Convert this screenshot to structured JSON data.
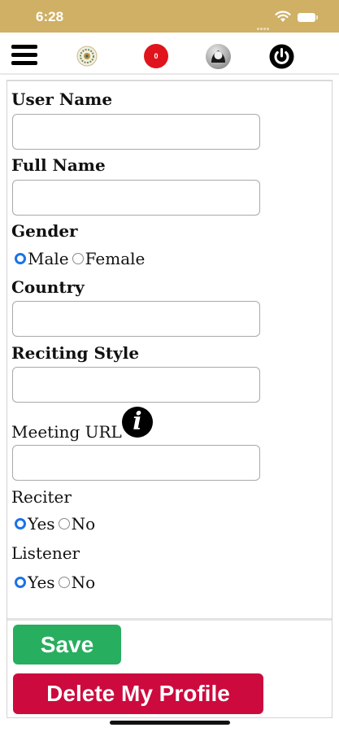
{
  "status_bar": {
    "time": "6:28"
  },
  "toolbar": {
    "notification_count": "0",
    "icons": [
      "menu-icon",
      "logo-icon",
      "notification-badge-icon",
      "user-avatar-icon",
      "power-icon"
    ]
  },
  "form": {
    "user_name": {
      "label": "User Name",
      "value": ""
    },
    "full_name": {
      "label": "Full Name",
      "value": ""
    },
    "gender": {
      "label": "Gender",
      "options": [
        "Male",
        "Female"
      ],
      "selected": "Male"
    },
    "country": {
      "label": "Country",
      "value": ""
    },
    "reciting_style": {
      "label": "Reciting Style",
      "value": ""
    },
    "meeting_url": {
      "label": "Meeting URL",
      "value": ""
    },
    "reciter": {
      "label": "Reciter",
      "options": [
        "Yes",
        "No"
      ],
      "selected": "Yes"
    },
    "listener": {
      "label": "Listener",
      "options": [
        "Yes",
        "No"
      ],
      "selected": "Yes"
    }
  },
  "buttons": {
    "save": "Save",
    "delete": "Delete My Profile"
  },
  "colors": {
    "status_bar": "#cfb065",
    "save": "#27ae5f",
    "delete": "#cc0a3e",
    "radio_selected": "#1a73e8",
    "notification_badge": "#e0141c"
  }
}
